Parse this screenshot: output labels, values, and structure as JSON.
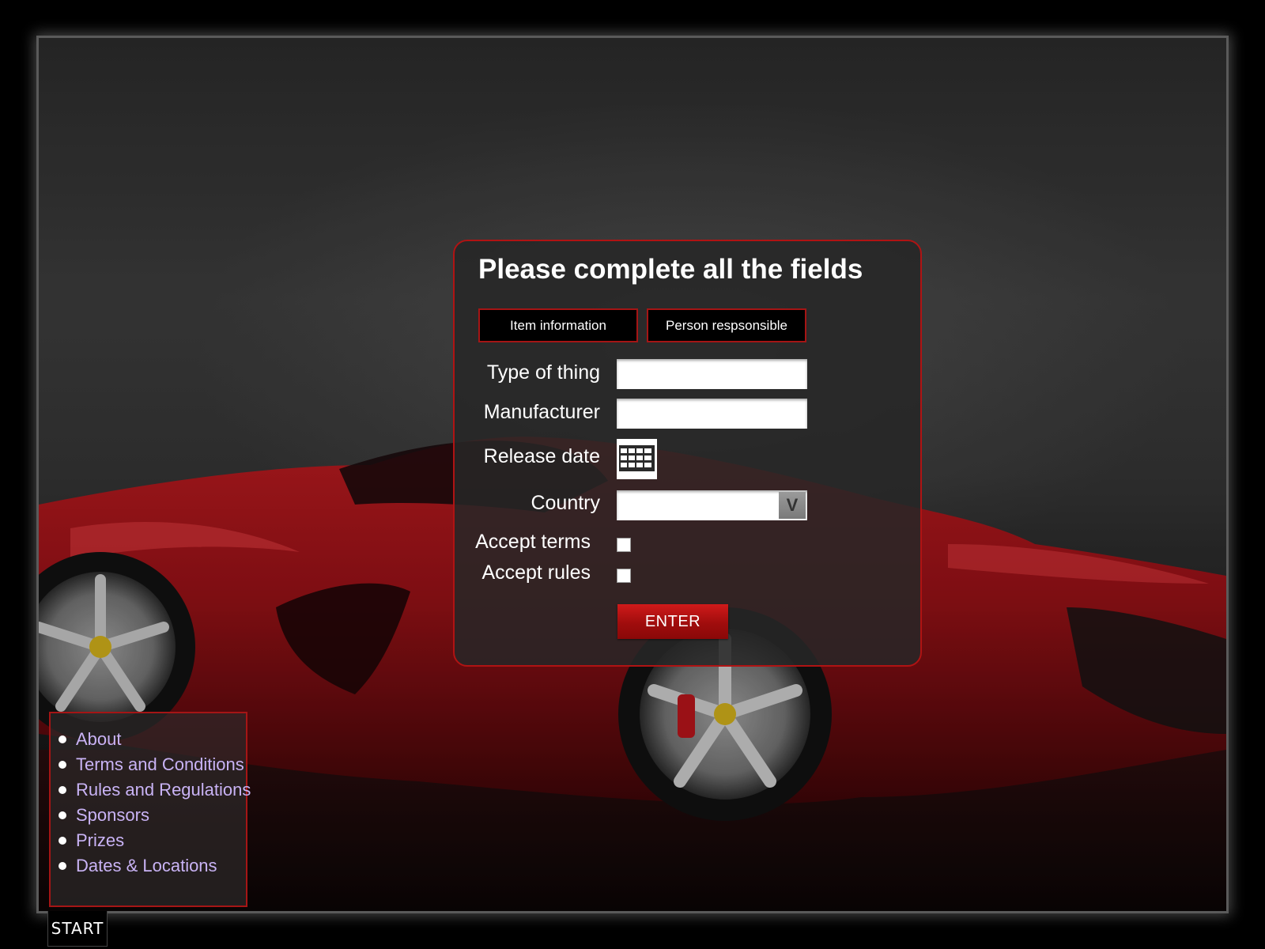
{
  "form": {
    "title": "Please complete all the fields",
    "tabs": [
      {
        "label": "Item information"
      },
      {
        "label": "Person respsonsible"
      }
    ],
    "fields": {
      "type_of_thing": {
        "label": "Type of thing",
        "value": ""
      },
      "manufacturer": {
        "label": "Manufacturer",
        "value": ""
      },
      "release_date": {
        "label": "Release date",
        "icon": "calendar-icon"
      },
      "country": {
        "label": "Country",
        "value": "",
        "arrow": "V"
      },
      "accept_terms": {
        "label": "Accept terms",
        "checked": false
      },
      "accept_rules": {
        "label": "Accept rules",
        "checked": false
      }
    },
    "submit_label": "ENTER"
  },
  "nav": {
    "items": [
      {
        "label": "About"
      },
      {
        "label": "Terms and Conditions"
      },
      {
        "label": "Rules and Regulations"
      },
      {
        "label": "Sponsors"
      },
      {
        "label": "Prizes"
      },
      {
        "label": "Dates & Locations"
      }
    ]
  },
  "start_label": "START",
  "colors": {
    "accent": "#a51515",
    "button": "#b00f0f",
    "link": "#c9b3f5",
    "panel": "#262626"
  }
}
